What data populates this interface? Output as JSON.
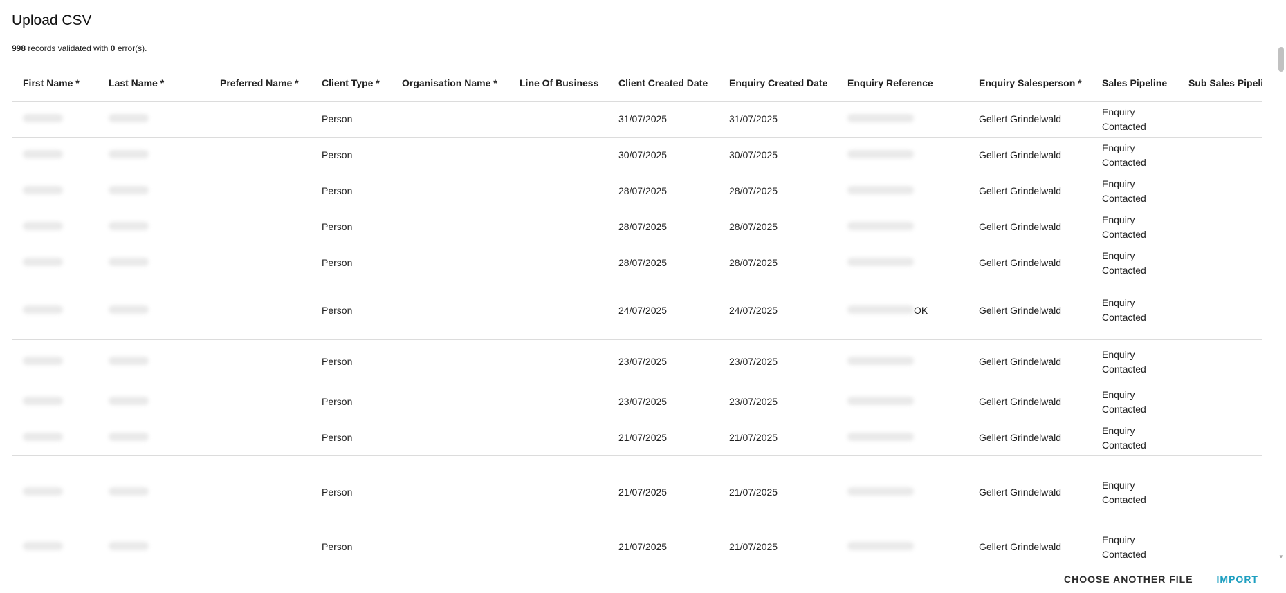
{
  "header": {
    "title": "Upload CSV",
    "summary_count": "998",
    "summary_mid": "records validated with",
    "summary_errors": "0",
    "summary_end": "error(s)."
  },
  "table": {
    "columns": [
      "First Name *",
      "Last Name *",
      "Preferred Name *",
      "Client Type *",
      "Organisation Name *",
      "Line Of Business",
      "Client Created Date",
      "Enquiry Created Date",
      "Enquiry Reference",
      "Enquiry Salesperson *",
      "Sales Pipeline",
      "Sub Sales Pipeline"
    ],
    "rows": [
      {
        "client_type": "Person",
        "client_created": "31/07/2025",
        "enquiry_created": "31/07/2025",
        "ref_suffix": "",
        "salesperson": "Gellert Grindelwald",
        "pipeline": "Enquiry Contacted"
      },
      {
        "client_type": "Person",
        "client_created": "30/07/2025",
        "enquiry_created": "30/07/2025",
        "ref_suffix": "",
        "salesperson": "Gellert Grindelwald",
        "pipeline": "Enquiry Contacted"
      },
      {
        "client_type": "Person",
        "client_created": "28/07/2025",
        "enquiry_created": "28/07/2025",
        "ref_suffix": "",
        "salesperson": "Gellert Grindelwald",
        "pipeline": "Enquiry Contacted"
      },
      {
        "client_type": "Person",
        "client_created": "28/07/2025",
        "enquiry_created": "28/07/2025",
        "ref_suffix": "",
        "salesperson": "Gellert Grindelwald",
        "pipeline": "Enquiry Contacted"
      },
      {
        "client_type": "Person",
        "client_created": "28/07/2025",
        "enquiry_created": "28/07/2025",
        "ref_suffix": "",
        "salesperson": "Gellert Grindelwald",
        "pipeline": "Enquiry Contacted"
      },
      {
        "client_type": "Person",
        "client_created": "24/07/2025",
        "enquiry_created": "24/07/2025",
        "ref_suffix": "OK",
        "salesperson": "Gellert Grindelwald",
        "pipeline": "Enquiry Contacted"
      },
      {
        "client_type": "Person",
        "client_created": "23/07/2025",
        "enquiry_created": "23/07/2025",
        "ref_suffix": "",
        "salesperson": "Gellert Grindelwald",
        "pipeline": "Enquiry Contacted"
      },
      {
        "client_type": "Person",
        "client_created": "23/07/2025",
        "enquiry_created": "23/07/2025",
        "ref_suffix": "",
        "salesperson": "Gellert Grindelwald",
        "pipeline": "Enquiry Contacted"
      },
      {
        "client_type": "Person",
        "client_created": "21/07/2025",
        "enquiry_created": "21/07/2025",
        "ref_suffix": "",
        "salesperson": "Gellert Grindelwald",
        "pipeline": "Enquiry Contacted"
      },
      {
        "client_type": "Person",
        "client_created": "21/07/2025",
        "enquiry_created": "21/07/2025",
        "ref_suffix": "",
        "salesperson": "Gellert Grindelwald",
        "pipeline": "Enquiry Contacted"
      },
      {
        "client_type": "Person",
        "client_created": "21/07/2025",
        "enquiry_created": "21/07/2025",
        "ref_suffix": "",
        "salesperson": "Gellert Grindelwald",
        "pipeline": "Enquiry Contacted"
      }
    ]
  },
  "actions": {
    "choose_another": "CHOOSE ANOTHER FILE",
    "import": "IMPORT"
  }
}
